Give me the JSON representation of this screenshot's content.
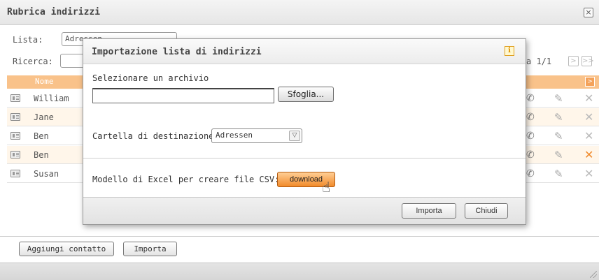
{
  "window": {
    "title": "Rubrica indirizzi",
    "close_glyph": "×"
  },
  "filters": {
    "list_label": "Lista:",
    "list_value": "Adressen",
    "search_label": "Ricerca:",
    "search_value": ""
  },
  "pager": {
    "text": "a 1/1",
    "next_glyph": ">",
    "last_glyph": ">>"
  },
  "table": {
    "column_name": "Nome",
    "header_arrow": ">",
    "rows": [
      {
        "name": "William"
      },
      {
        "name": "Jane"
      },
      {
        "name": "Ben"
      },
      {
        "name": "Ben"
      },
      {
        "name": "Susan"
      }
    ]
  },
  "footer": {
    "add_contact": "Aggiungi contatto",
    "import": "Importa"
  },
  "dialog": {
    "title": "Importazione lista di indirizzi",
    "info_glyph": "i",
    "select_file_label": "Selezionare un archivio",
    "browse_label": "Sfoglia...",
    "destination_label": "Cartella di destinazione",
    "destination_value": "Adressen",
    "excel_label": "Modello di Excel per creare file CSV:",
    "download_label": "download",
    "import_button": "Importa",
    "close_button": "Chiudi"
  },
  "icons": {
    "row_card": "contact-card-icon",
    "phone": "phone-icon",
    "edit": "pencil-icon",
    "delete": "delete-icon",
    "cursor": "hand-cursor-icon"
  },
  "colors": {
    "table_header": "#f9c28a",
    "alt_row": "#fff6ea",
    "download_button": "#f18a2a",
    "delete_hot": "#f08a2c"
  }
}
